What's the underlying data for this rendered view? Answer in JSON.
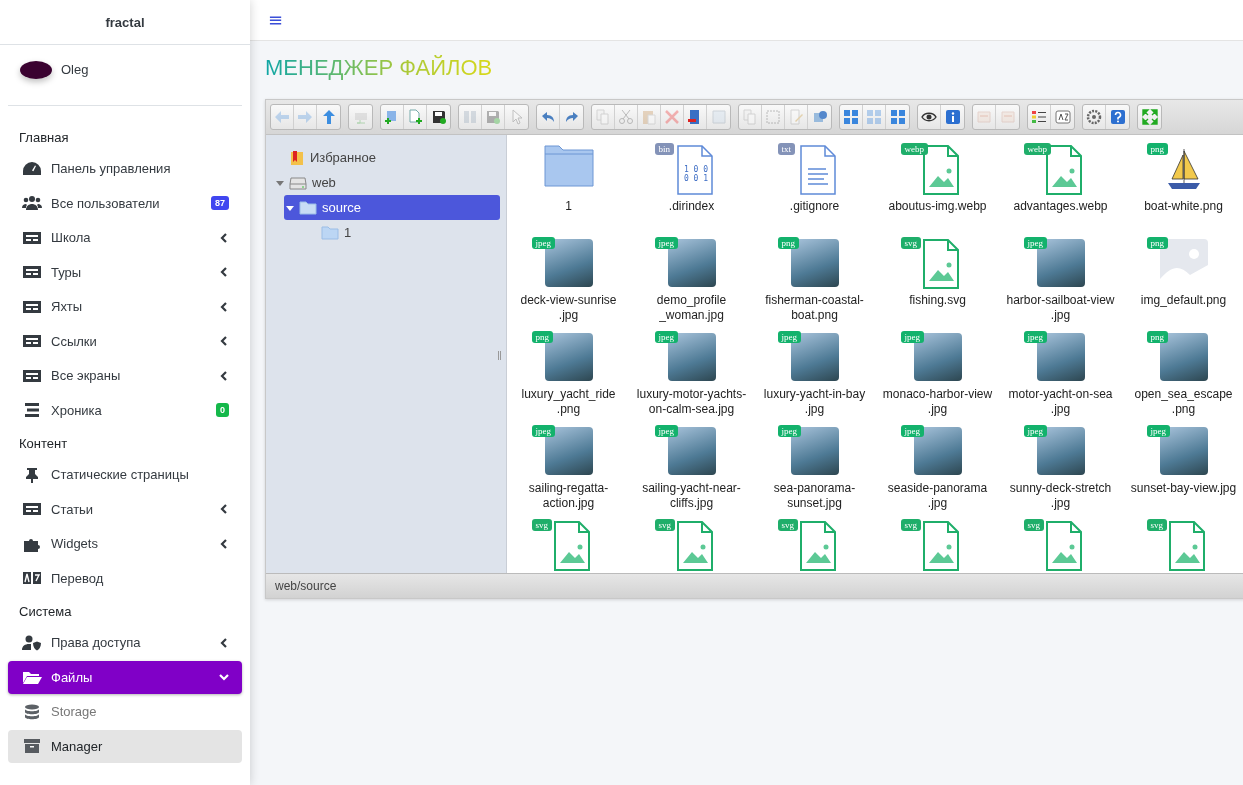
{
  "sidebar": {
    "brand": "fractal",
    "user": {
      "name": "Oleg"
    },
    "sections": [
      {
        "title": "Главная",
        "items": [
          {
            "label": "Панель управления",
            "selected": false
          },
          {
            "label": "Все пользователи",
            "selected": false,
            "badge": {
              "text": "87",
              "color": "#4046f0"
            }
          },
          {
            "label": "Школа",
            "expanded": false,
            "selected": false
          },
          {
            "label": "Туры",
            "expanded": false,
            "selected": false
          },
          {
            "label": "Яхты",
            "expanded": false,
            "selected": false
          },
          {
            "label": "Ссылки",
            "expanded": false,
            "selected": false
          },
          {
            "label": "Все экраны",
            "expanded": false,
            "selected": false
          },
          {
            "label": "Хроника",
            "selected": false,
            "badge": {
              "text": "0",
              "color": "#14b84a"
            }
          }
        ]
      },
      {
        "title": "Контент",
        "items": [
          {
            "label": "Статические страницы",
            "selected": false
          },
          {
            "label": "Статьи",
            "expanded": false,
            "selected": false
          },
          {
            "label": "Widgets",
            "expanded": false,
            "selected": false
          },
          {
            "label": "Перевод",
            "selected": false
          }
        ]
      },
      {
        "title": "Система",
        "items": [
          {
            "label": "Права доступа",
            "expanded": false,
            "selected": false
          },
          {
            "label": "Файлы",
            "expanded": true,
            "selected": true,
            "children": [
              {
                "label": "Storage",
                "selected": false
              },
              {
                "label": "Manager",
                "selected": true
              }
            ]
          }
        ]
      }
    ]
  },
  "topbar": {
    "menu_glyph": "≡"
  },
  "page_title": "МЕНЕДЖЕР ФАЙЛОВ",
  "file_manager": {
    "toolbar": [
      [
        {
          "disabled": true
        },
        {
          "disabled": true
        },
        {
          "disabled": false
        }
      ],
      [
        {
          "disabled": true
        }
      ],
      [
        {
          "disabled": false
        },
        {
          "disabled": false
        },
        {
          "disabled": false
        }
      ],
      [
        {
          "disabled": true
        },
        {
          "disabled": true
        },
        {
          "disabled": true
        }
      ],
      [
        {
          "disabled": false
        },
        {
          "disabled": false
        }
      ],
      [
        {
          "disabled": true
        },
        {
          "disabled": true
        },
        {
          "disabled": true
        },
        {
          "disabled": true
        },
        {
          "disabled": false
        },
        {
          "disabled": true
        }
      ],
      [
        {
          "disabled": true
        },
        {
          "disabled": true
        },
        {
          "disabled": true
        },
        {
          "disabled": false
        }
      ],
      [
        {
          "disabled": false
        },
        {
          "disabled": true
        },
        {
          "disabled": false
        }
      ],
      [
        {
          "disabled": false
        },
        {
          "disabled": false
        }
      ],
      [
        {
          "disabled": true
        },
        {
          "disabled": true
        }
      ],
      [
        {
          "disabled": false
        },
        {
          "disabled": false
        }
      ],
      [
        {
          "disabled": false
        },
        {
          "disabled": false
        }
      ],
      [
        {
          "disabled": false
        }
      ]
    ],
    "tree": [
      {
        "kind": "favorites",
        "label": "Избранное",
        "selected": false
      },
      {
        "kind": "drive",
        "label": "web",
        "expanded": true,
        "selected": false,
        "children": [
          {
            "kind": "folder",
            "label": "source",
            "expanded": true,
            "selected": true,
            "children": [
              {
                "kind": "folder",
                "label": "1",
                "selected": false
              }
            ]
          }
        ]
      }
    ],
    "files": [
      {
        "kind": "folder",
        "label_lines": [
          "1"
        ]
      },
      {
        "kind": "document",
        "badge": "bin",
        "glyph_lines": [
          "1 0 0",
          "0 0 1"
        ],
        "label_lines": [
          ".dirindex"
        ]
      },
      {
        "kind": "document",
        "badge": "txt",
        "label_lines": [
          ".gitignore"
        ]
      },
      {
        "kind": "image-doc",
        "badge": "webp",
        "label_lines": [
          "aboutus-img.webp"
        ]
      },
      {
        "kind": "image-doc",
        "badge": "webp",
        "label_lines": [
          "advantages.webp"
        ]
      },
      {
        "kind": "sailboat",
        "badge": "png",
        "label_lines": [
          "boat-white.png"
        ]
      },
      {
        "kind": "photo",
        "badge": "jpeg",
        "label_lines": [
          "deck-view-sunrise",
          ".jpg"
        ]
      },
      {
        "kind": "photo",
        "badge": "jpeg",
        "label_lines": [
          "demo_profile",
          "_woman.jpg"
        ]
      },
      {
        "kind": "photo",
        "badge": "png",
        "label_lines": [
          "fisherman-coastal-",
          "boat.png"
        ]
      },
      {
        "kind": "image-doc",
        "badge": "svg",
        "label_lines": [
          "fishing.svg"
        ]
      },
      {
        "kind": "photo",
        "badge": "jpeg",
        "label_lines": [
          "harbor-sailboat-view",
          ".jpg"
        ]
      },
      {
        "kind": "placeholder",
        "badge": "png",
        "label_lines": [
          "img_default.png"
        ]
      },
      {
        "kind": "photo",
        "badge": "png",
        "label_lines": [
          "luxury_yacht_ride",
          ".png"
        ]
      },
      {
        "kind": "photo",
        "badge": "jpeg",
        "label_lines": [
          "luxury-motor-yachts-",
          "on-calm-sea.jpg"
        ]
      },
      {
        "kind": "photo",
        "badge": "jpeg",
        "label_lines": [
          "luxury-yacht-in-bay",
          ".jpg"
        ]
      },
      {
        "kind": "photo",
        "badge": "jpeg",
        "label_lines": [
          "monaco-harbor-view",
          ".jpg"
        ]
      },
      {
        "kind": "photo",
        "badge": "jpeg",
        "label_lines": [
          "motor-yacht-on-sea",
          ".jpg"
        ]
      },
      {
        "kind": "photo",
        "badge": "png",
        "label_lines": [
          "open_sea_escape",
          ".png"
        ]
      },
      {
        "kind": "photo",
        "badge": "jpeg",
        "label_lines": [
          "sailing-regatta-",
          "action.jpg"
        ]
      },
      {
        "kind": "photo",
        "badge": "jpeg",
        "label_lines": [
          "sailing-yacht-near-",
          "cliffs.jpg"
        ]
      },
      {
        "kind": "photo",
        "badge": "jpeg",
        "label_lines": [
          "sea-panorama-",
          "sunset.jpg"
        ]
      },
      {
        "kind": "photo",
        "badge": "jpeg",
        "label_lines": [
          "seaside-panorama",
          ".jpg"
        ]
      },
      {
        "kind": "photo",
        "badge": "jpeg",
        "label_lines": [
          "sunny-deck-stretch",
          ".jpg"
        ]
      },
      {
        "kind": "photo",
        "badge": "jpeg",
        "label_lines": [
          "sunset-bay-view.jpg"
        ]
      },
      {
        "kind": "image-doc",
        "badge": "svg"
      },
      {
        "kind": "image-doc",
        "badge": "svg"
      },
      {
        "kind": "image-doc",
        "badge": "svg"
      },
      {
        "kind": "image-doc",
        "badge": "svg"
      },
      {
        "kind": "image-doc",
        "badge": "svg"
      },
      {
        "kind": "image-doc",
        "badge": "svg"
      }
    ],
    "status_bar": "web/source"
  }
}
